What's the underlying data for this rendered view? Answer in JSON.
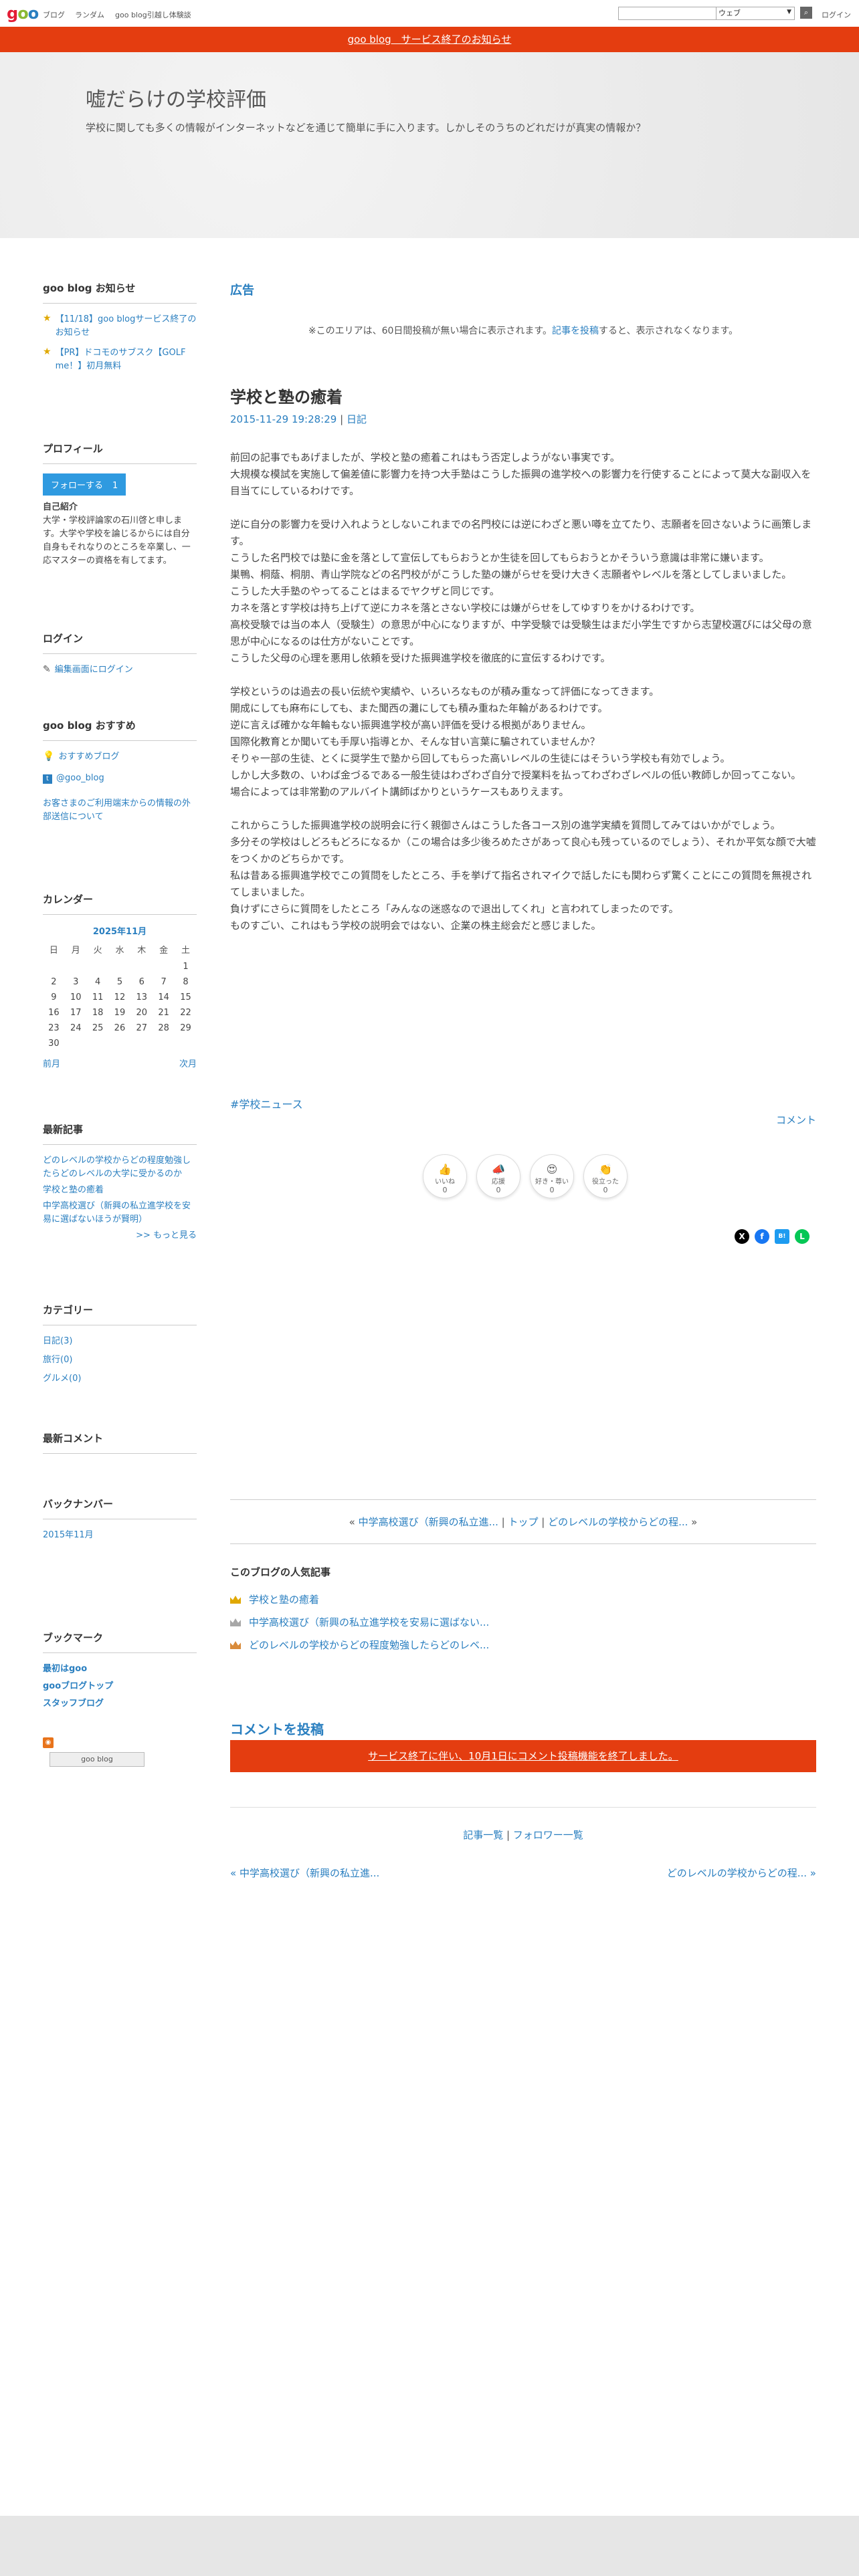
{
  "topbar": {
    "logo": "goo",
    "nav": [
      "ブログ",
      "ランダム",
      "goo blog引越し体験談"
    ],
    "search_placeholder": "",
    "search_scope": "ウェブ",
    "search_button": "検索",
    "login": "ログイン"
  },
  "banner": {
    "text": "goo blog　サービス終了のお知らせ"
  },
  "header": {
    "title": "嘘だらけの学校評価",
    "description": "学校に関しても多くの情報がインターネットなどを通じて簡単に手に入ります。しかしそのうちのどれだけが真実の情報か？"
  },
  "sidebar": {
    "notice": {
      "heading": "goo blog お知らせ",
      "items": [
        "【11/18】goo blogサービス終了のお知らせ",
        "【PR】ドコモのサブスク【GOLF me！】初月無料"
      ]
    },
    "profile": {
      "heading": "プロフィール",
      "follow_label": "フォローする",
      "follow_count": "1",
      "intro_title": "自己紹介",
      "intro": "大学・学校評論家の石川啓と申します。大学や学校を論じるからには自分自身もそれなりのところを卒業し、一応マスターの資格を有してます。"
    },
    "login": {
      "heading": "ログイン",
      "edit_link": "編集画面にログイン"
    },
    "recommend": {
      "heading": "goo blog おすすめ",
      "items": [
        "おすすめブログ",
        "@goo_blog",
        "お客さまのご利用端末からの情報の外部送信について"
      ]
    },
    "calendar": {
      "heading": "カレンダー",
      "month": "2025年11月",
      "weekdays": [
        "日",
        "月",
        "火",
        "水",
        "木",
        "金",
        "土"
      ],
      "weeks": [
        [
          "",
          "",
          "",
          "",
          "",
          "",
          "1"
        ],
        [
          "2",
          "3",
          "4",
          "5",
          "6",
          "7",
          "8"
        ],
        [
          "9",
          "10",
          "11",
          "12",
          "13",
          "14",
          "15"
        ],
        [
          "16",
          "17",
          "18",
          "19",
          "20",
          "21",
          "22"
        ],
        [
          "23",
          "24",
          "25",
          "26",
          "27",
          "28",
          "29"
        ],
        [
          "30",
          "",
          "",
          "",
          "",
          "",
          ""
        ]
      ],
      "prev": "前月",
      "next": "次月"
    },
    "recent": {
      "heading": "最新記事",
      "items": [
        "どのレベルの学校からどの程度勉強したらどのレベルの大学に受かるのか",
        "学校と塾の癒着",
        "中学高校選び（新興の私立進学校を安易に選ばないほうが賢明）"
      ],
      "more": ">> もっと見る"
    },
    "category": {
      "heading": "カテゴリー",
      "items": [
        "日記(3)",
        "旅行(0)",
        "グルメ(0)"
      ]
    },
    "comments": {
      "heading": "最新コメント"
    },
    "backnumber": {
      "heading": "バックナンバー",
      "items": [
        "2015年11月"
      ]
    },
    "bookmark": {
      "heading": "ブックマーク",
      "items": [
        "最初はgoo",
        "gooブログトップ",
        "スタッフブログ"
      ],
      "badge": "goo blog"
    }
  },
  "main": {
    "ad_heading": "広告",
    "ad_note_pre": "※このエリアは、60日間投稿が無い場合に表示されます。",
    "ad_note_link": "記事を投稿",
    "ad_note_post": "すると、表示されなくなります。",
    "article": {
      "title": "学校と塾の癒着",
      "datetime": "2015-11-29 19:28:29",
      "category": "日記",
      "paragraphs": [
        [
          "前回の記事でもあげましたが、学校と塾の癒着これはもう否定しようがない事実です。",
          "大規模な模試を実施して偏差値に影響力を持つ大手塾はこうした振興の進学校への影響力を行使することによって莫大な副収入を目当てにしているわけです。"
        ],
        [
          "逆に自分の影響力を受け入れようとしないこれまでの名門校には逆にわざと悪い噂を立てたり、志願者を回さないように画策します。",
          "こうした名門校では塾に金を落として宣伝してもらおうとか生徒を回してもらおうとかそういう意識は非常に嫌います。",
          "巣鴨、桐蔭、桐朋、青山学院などの名門校ががこうした塾の嫌がらせを受け大きく志願者やレベルを落としてしまいました。",
          "こうした大手塾のやってることはまるでヤクザと同じです。",
          "カネを落とす学校は持ち上げて逆にカネを落とさない学校には嫌がらせをしてゆすりをかけるわけです。",
          "高校受験では当の本人（受験生）の意思が中心になりますが、中学受験では受験生はまだ小学生ですから志望校選びには父母の意思が中心になるのは仕方がないことです。",
          "こうした父母の心理を悪用し依頼を受けた振興進学校を徹底的に宣伝するわけです。"
        ],
        [
          "学校というのは過去の長い伝統や実績や、いろいろなものが積み重なって評価になってきます。",
          "開成にしても麻布にしても、また聞西の灘にしても積み重ねた年輪があるわけです。",
          "逆に言えば確かな年輪もない振興進学校が高い評価を受ける根拠がありません。",
          "国際化教育とか聞いても手厚い指導とか、そんな甘い言葉に騙されていませんか？",
          "そりゃ一部の生徒、とくに奨学生で塾から回してもらった高いレベルの生徒にはそういう学校も有効でしょう。",
          "しかし大多数の、いわば金づるである一般生徒はわざわざ自分で授業料を払ってわざわざレベルの低い教師しか回ってこない。",
          "場合によっては非常勤のアルバイト講師ばかりというケースもありえます。"
        ],
        [
          "これからこうした振興進学校の説明会に行く親御さんはこうした各コース別の進学実績を質問してみてはいかがでしょう。",
          "多分その学校はしどろもどろになるか（この場合は多少後ろめたさがあって良心も残っているのでしょう）、それか平気な顔で大嘘をつくかのどちらかです。",
          "私は昔ある振興進学校でこの質問をしたところ、手を挙げて指名されマイクで話したにも関わらず驚くことにこの質問を無視されてしまいました。",
          "負けずにさらに質問をしたところ「みんなの迷惑なので退出してくれ」と言われてしまったのです。",
          "ものすごい、これはもう学校の説明会ではない、企業の株主総会だと感じました。"
        ]
      ],
      "tag": "#学校ニュース",
      "comment": "コメント"
    },
    "reactions": [
      {
        "name": "いいね",
        "count": "0"
      },
      {
        "name": "応援",
        "count": "0"
      },
      {
        "name": "好き・尊い",
        "count": "0"
      },
      {
        "name": "役立った",
        "count": "0"
      }
    ],
    "share": [
      "X",
      "f",
      "B!",
      "L"
    ],
    "post_nav": {
      "prev": "中学高校選び（新興の私立進...",
      "top": "トップ",
      "next": "どのレベルの学校からどの程..."
    },
    "popular": {
      "heading": "このブログの人気記事",
      "items": [
        "学校と塾の癒着",
        "中学高校選び（新興の私立進学校を安易に選ばない...",
        "どのレベルの学校からどの程度勉強したらどのレベ..."
      ]
    },
    "comment_post": {
      "heading": "コメントを投稿",
      "closed": "サービス終了に伴い、10月1日にコメント投稿機能を終了しました。"
    },
    "bottom": {
      "list": "記事一覧",
      "follower": "フォロワー一覧"
    },
    "pager": {
      "prev": "« 中学高校選び（新興の私立進...",
      "next": "どのレベルの学校からどの程... »"
    }
  },
  "colors": {
    "accent": "#2a7fc0",
    "alert": "#e43d10"
  }
}
